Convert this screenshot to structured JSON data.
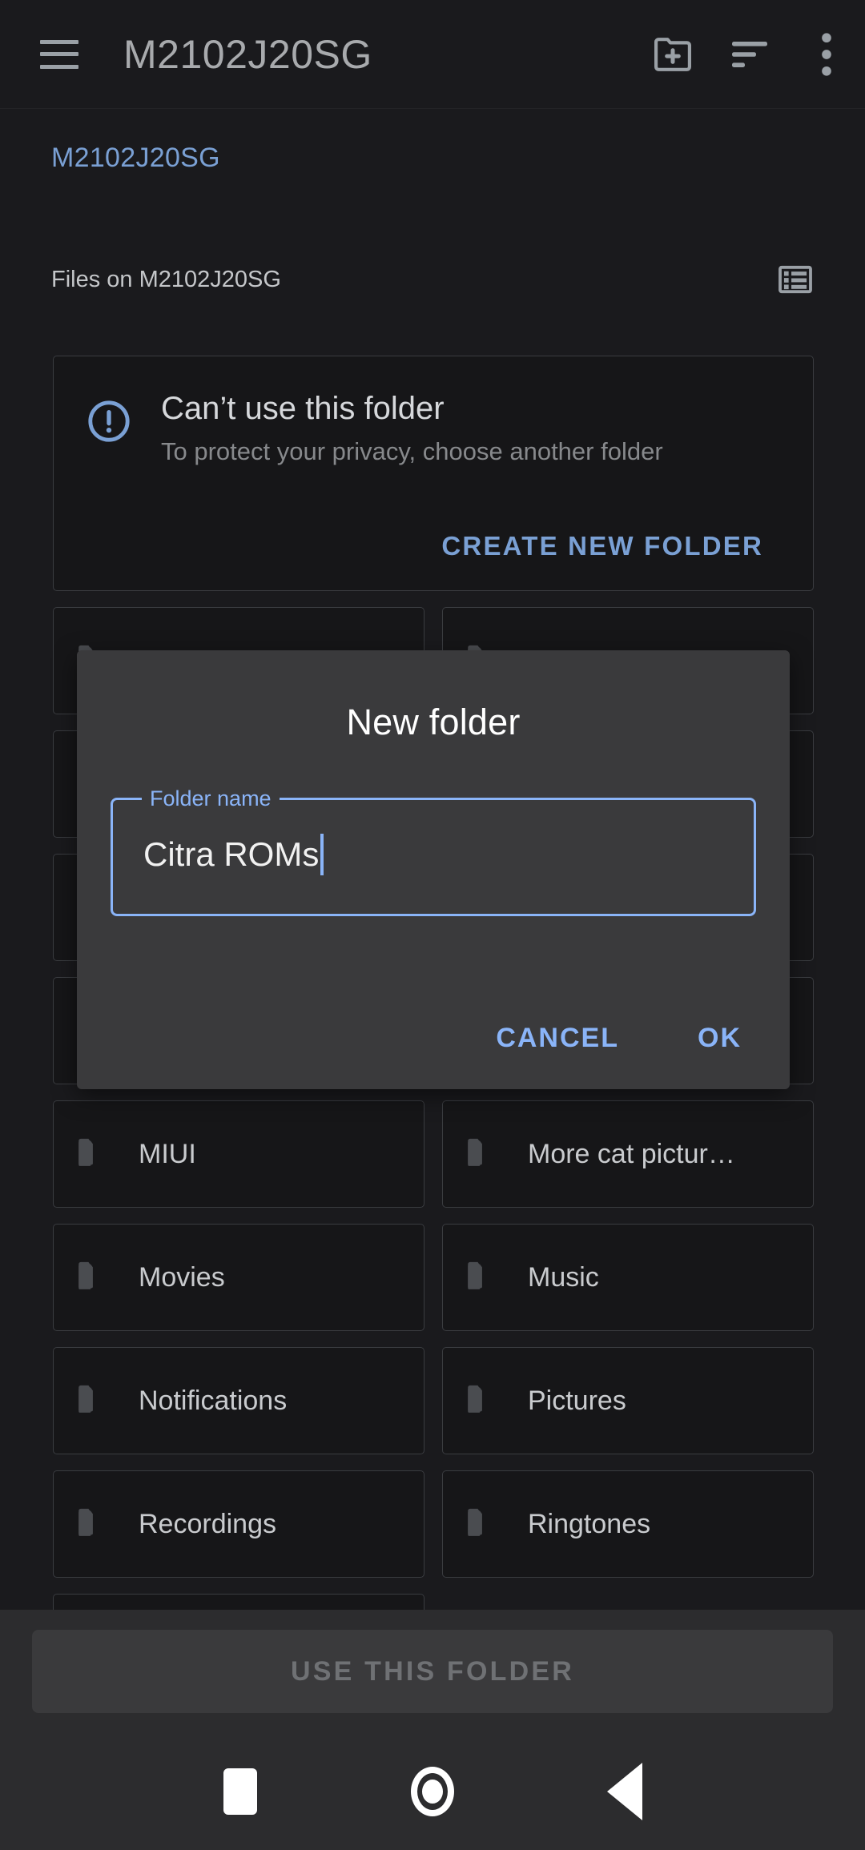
{
  "appbar": {
    "menu_icon": "hamburger-menu-icon",
    "title": "M2102J20SG",
    "actions": [
      {
        "name": "create-new-folder-icon",
        "label": "Create new folder"
      },
      {
        "name": "sort-icon",
        "label": "Sort"
      },
      {
        "name": "more-options-icon",
        "label": "More options"
      }
    ]
  },
  "breadcrumb": {
    "current": "M2102J20SG"
  },
  "section": {
    "label": "Files on M2102J20SG",
    "view_toggle_icon": "list-view-icon"
  },
  "warning": {
    "icon": "error-outline-icon",
    "title": "Can’t use this folder",
    "subtitle": "To protect your privacy, choose another folder",
    "action_label": "CREATE NEW FOLDER"
  },
  "folders": [
    {
      "label": ""
    },
    {
      "label": ""
    },
    {
      "label": ""
    },
    {
      "label": ""
    },
    {
      "label": ""
    },
    {
      "label": ""
    },
    {
      "label": ""
    },
    {
      "label": ""
    },
    {
      "label": "MIUI"
    },
    {
      "label": "More cat pictur…"
    },
    {
      "label": "Movies"
    },
    {
      "label": "Music"
    },
    {
      "label": "Notifications"
    },
    {
      "label": "Pictures"
    },
    {
      "label": "Recordings"
    },
    {
      "label": "Ringtones"
    },
    {
      "label": ""
    }
  ],
  "dialog": {
    "title": "New folder",
    "field": {
      "label": "Folder name",
      "value": "Citra ROMs",
      "placeholder": "Folder name"
    },
    "cancel_label": "CANCEL",
    "ok_label": "OK"
  },
  "bottom_bar": {
    "use_folder_label": "USE THIS FOLDER",
    "use_folder_enabled": false
  },
  "navbar": {
    "recents_icon": "square-recents-icon",
    "home_icon": "circle-home-icon",
    "back_icon": "triangle-back-icon"
  },
  "colors": {
    "background": "#1a1a1d",
    "card_bg": "#161618",
    "card_border": "#3a3c40",
    "accent_blue": "#7aa0d4",
    "dialog_accent": "#8ab4f8",
    "dialog_bg": "#3a3a3c",
    "text_primary": "#d6d8db",
    "text_secondary": "#87898c",
    "navbar_bg": "#2c2c2e"
  }
}
